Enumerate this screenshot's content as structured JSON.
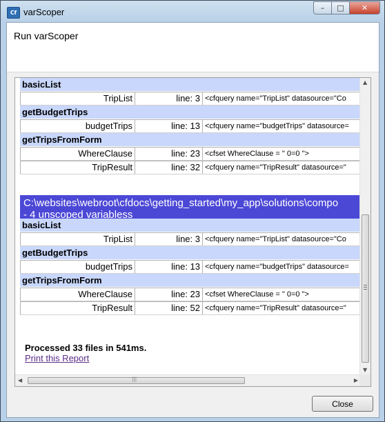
{
  "window": {
    "app_icon_text": "Cf",
    "title": "varScoper",
    "controls": {
      "minimize": "–",
      "maximize": "□",
      "close": "✕"
    }
  },
  "dialog": {
    "heading": "Run varScoper",
    "close_button": "Close"
  },
  "report": {
    "blocks": [
      {
        "functions": [
          {
            "name": "basicList",
            "vars": [
              {
                "name": "TripList",
                "line": "line: 3",
                "code": "<cfquery name=\"TripList\" datasource=\"Co"
              }
            ]
          },
          {
            "name": "getBudgetTrips",
            "vars": [
              {
                "name": "budgetTrips",
                "line": "line: 13",
                "code": "<cfquery name=\"budgetTrips\" datasource="
              }
            ]
          },
          {
            "name": "getTripsFromForm",
            "vars": [
              {
                "name": "WhereClause",
                "line": "line: 23",
                "code": "<cfset WhereClause = \" 0=0 \">"
              },
              {
                "name": "TripResult",
                "line": "line: 32",
                "code": "<cfquery name=\"TripResult\" datasource=\""
              }
            ]
          }
        ]
      },
      {
        "header_path": "C:\\websites\\webroot\\cfdocs\\getting_started\\my_app\\solutions\\compo",
        "header_count": "- 4 unscoped variabless",
        "functions": [
          {
            "name": "basicList",
            "vars": [
              {
                "name": "TripList",
                "line": "line: 3",
                "code": "<cfquery name=\"TripList\" datasource=\"Co"
              }
            ]
          },
          {
            "name": "getBudgetTrips",
            "vars": [
              {
                "name": "budgetTrips",
                "line": "line: 13",
                "code": "<cfquery name=\"budgetTrips\" datasource="
              }
            ]
          },
          {
            "name": "getTripsFromForm",
            "vars": [
              {
                "name": "WhereClause",
                "line": "line: 23",
                "code": "<cfset WhereClause = \" 0=0 \">"
              },
              {
                "name": "TripResult",
                "line": "line: 52",
                "code": "<cfquery name=\"TripResult\" datasource=\""
              }
            ]
          }
        ]
      }
    ],
    "processed": "Processed 33 files in 541ms.",
    "print_link": "Print this Report"
  },
  "scroll_arrows": {
    "up": "▲",
    "down": "▼",
    "left": "◀",
    "right": "▶",
    "hgrip": "|||"
  }
}
